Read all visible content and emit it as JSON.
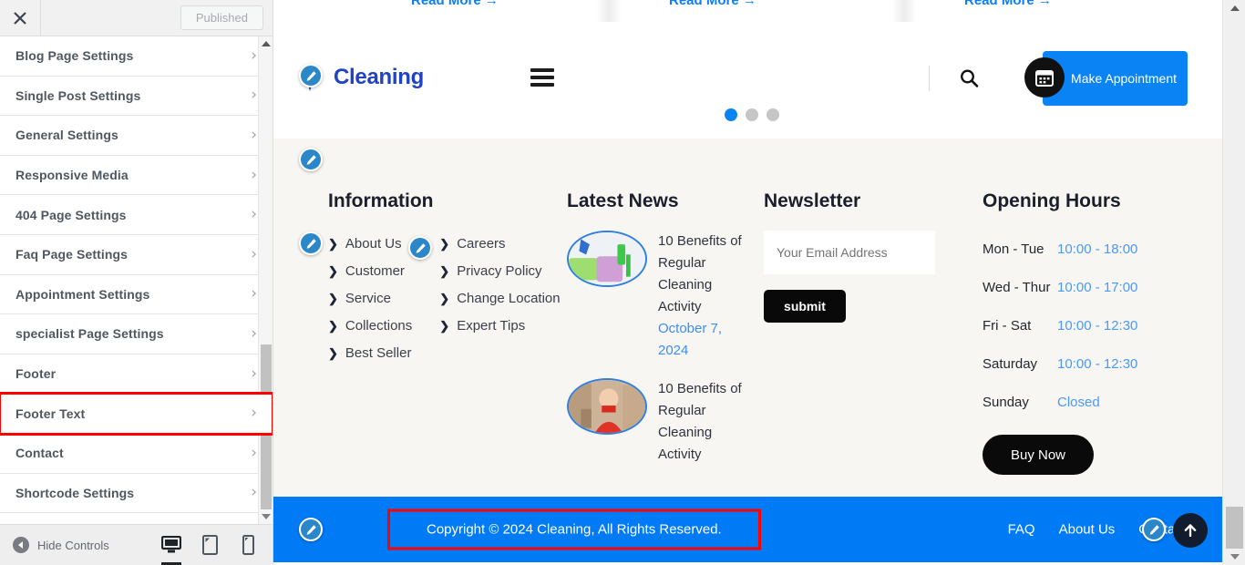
{
  "customizer": {
    "close_label": "×",
    "published_label": "Published",
    "hide_controls_label": "Hide Controls",
    "items": [
      {
        "label": "Blog Page Settings",
        "highlighted": false
      },
      {
        "label": "Single Post Settings",
        "highlighted": false
      },
      {
        "label": "General Settings",
        "highlighted": false
      },
      {
        "label": "Responsive Media",
        "highlighted": false
      },
      {
        "label": "404 Page Settings",
        "highlighted": false
      },
      {
        "label": "Faq Page Settings",
        "highlighted": false
      },
      {
        "label": "Appointment Settings",
        "highlighted": false
      },
      {
        "label": "specialist Page Settings",
        "highlighted": false
      },
      {
        "label": "Footer",
        "highlighted": false
      },
      {
        "label": "Footer Text",
        "highlighted": true
      },
      {
        "label": "Contact",
        "highlighted": false
      },
      {
        "label": "Shortcode Settings",
        "highlighted": false
      }
    ],
    "devices": [
      {
        "name": "desktop",
        "active": true
      },
      {
        "name": "tablet",
        "active": false
      },
      {
        "name": "mobile",
        "active": false
      }
    ]
  },
  "preview": {
    "read_more_label": "Read More →",
    "header": {
      "logo_text": "Cleaning",
      "appointment_label": "Make Appointment",
      "search_icon": "search-icon",
      "menu_icon": "hamburger-icon",
      "calendar_icon": "calendar-icon"
    },
    "carousel": {
      "dots": 3,
      "active_index": 0
    },
    "footer": {
      "information": {
        "title": "Information",
        "column_one": [
          "About Us",
          "Customer",
          "Service",
          "Collections",
          "Best Seller"
        ],
        "column_two": [
          "Careers",
          "Privacy Policy",
          "Change Location",
          "Expert Tips"
        ]
      },
      "latest_news": {
        "title": "Latest News",
        "items": [
          {
            "title": "10 Benefits of Regular Cleaning Activity",
            "date": "October 7, 2024"
          },
          {
            "title": "10 Benefits of Regular Cleaning Activity",
            "date": ""
          }
        ]
      },
      "newsletter": {
        "title": "Newsletter",
        "placeholder": "Your Email Address",
        "value": "",
        "submit_label": "submit"
      },
      "opening_hours": {
        "title": "Opening Hours",
        "rows": [
          {
            "day": "Mon - Tue",
            "time": "10:00 - 18:00"
          },
          {
            "day": "Wed - Thur",
            "time": "10:00 - 17:00"
          },
          {
            "day": "Fri - Sat",
            "time": "10:00 - 12:30"
          },
          {
            "day": "Saturday",
            "time": "10:00 - 12:30"
          },
          {
            "day": "Sunday",
            "time": "Closed"
          }
        ],
        "buy_now_label": "Buy Now"
      },
      "copyright": {
        "text": "Copyright © 2024 Cleaning, All Rights Reserved.",
        "links": [
          "FAQ",
          "About Us",
          "Contact"
        ]
      }
    }
  },
  "colors": {
    "brand_blue": "#007bf5",
    "logo_blue": "#1f43c4",
    "footer_bg": "#f7f6f2",
    "highlight_red": "#ff0000",
    "link_blue": "#4a9af5",
    "dark": "#0a0a0a"
  }
}
